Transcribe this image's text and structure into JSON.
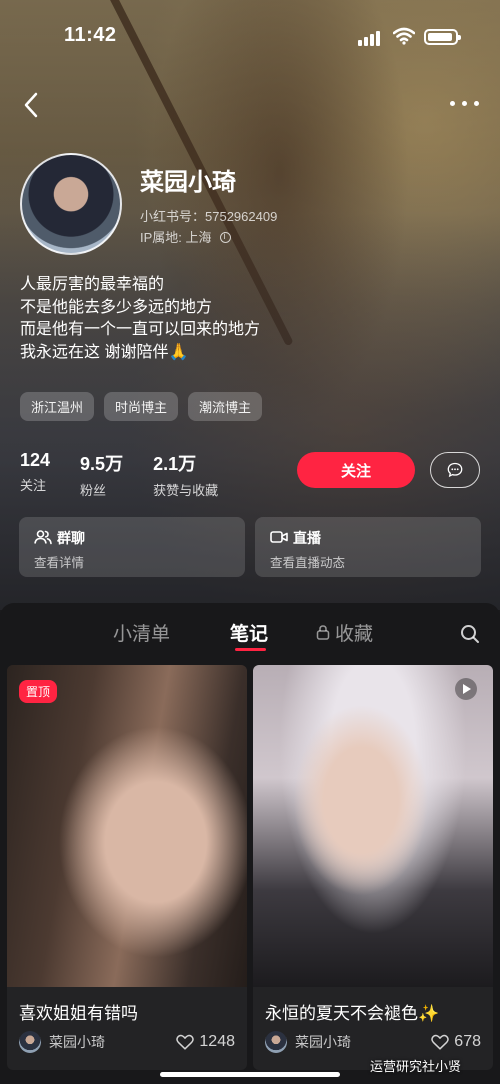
{
  "status_bar": {
    "time": "11:42"
  },
  "profile": {
    "nickname": "菜园小琦",
    "red_id": "小红书号：5752962409",
    "ip_location": "IP属地: 上海",
    "bio": [
      "人最厉害的最幸福的",
      "不是他能去多少多远的地方",
      "而是他有一个一直可以回来的地方",
      "我永远在这 谢谢陪伴🙏"
    ],
    "tags": [
      "浙江温州",
      "时尚博主",
      "潮流博主"
    ],
    "stats": [
      {
        "num": "124",
        "label": "关注"
      },
      {
        "num": "9.5万",
        "label": "粉丝"
      },
      {
        "num": "2.1万",
        "label": "获赞与收藏"
      }
    ],
    "follow_label": "关注"
  },
  "cards": [
    {
      "title": "群聊",
      "subtitle": "查看详情",
      "icon": "group-chat-icon"
    },
    {
      "title": "直播",
      "subtitle": "查看直播动态",
      "icon": "live-icon"
    }
  ],
  "tabs": [
    {
      "label": "小清单",
      "active": false
    },
    {
      "label": "笔记",
      "active": true
    },
    {
      "label": "收藏",
      "active": false,
      "icon": "lock-icon"
    }
  ],
  "notes": [
    {
      "badge": "置顶",
      "title": "喜欢姐姐有错吗",
      "author": "菜园小琦",
      "likes": "1248"
    },
    {
      "badge": "",
      "title": "永恒的夏天不会褪色✨",
      "author": "菜园小琦",
      "likes": "678",
      "video": true
    }
  ],
  "watermark": "运营研究社小贤",
  "colors": {
    "accent": "#ff2442",
    "panel": "#18181a"
  }
}
